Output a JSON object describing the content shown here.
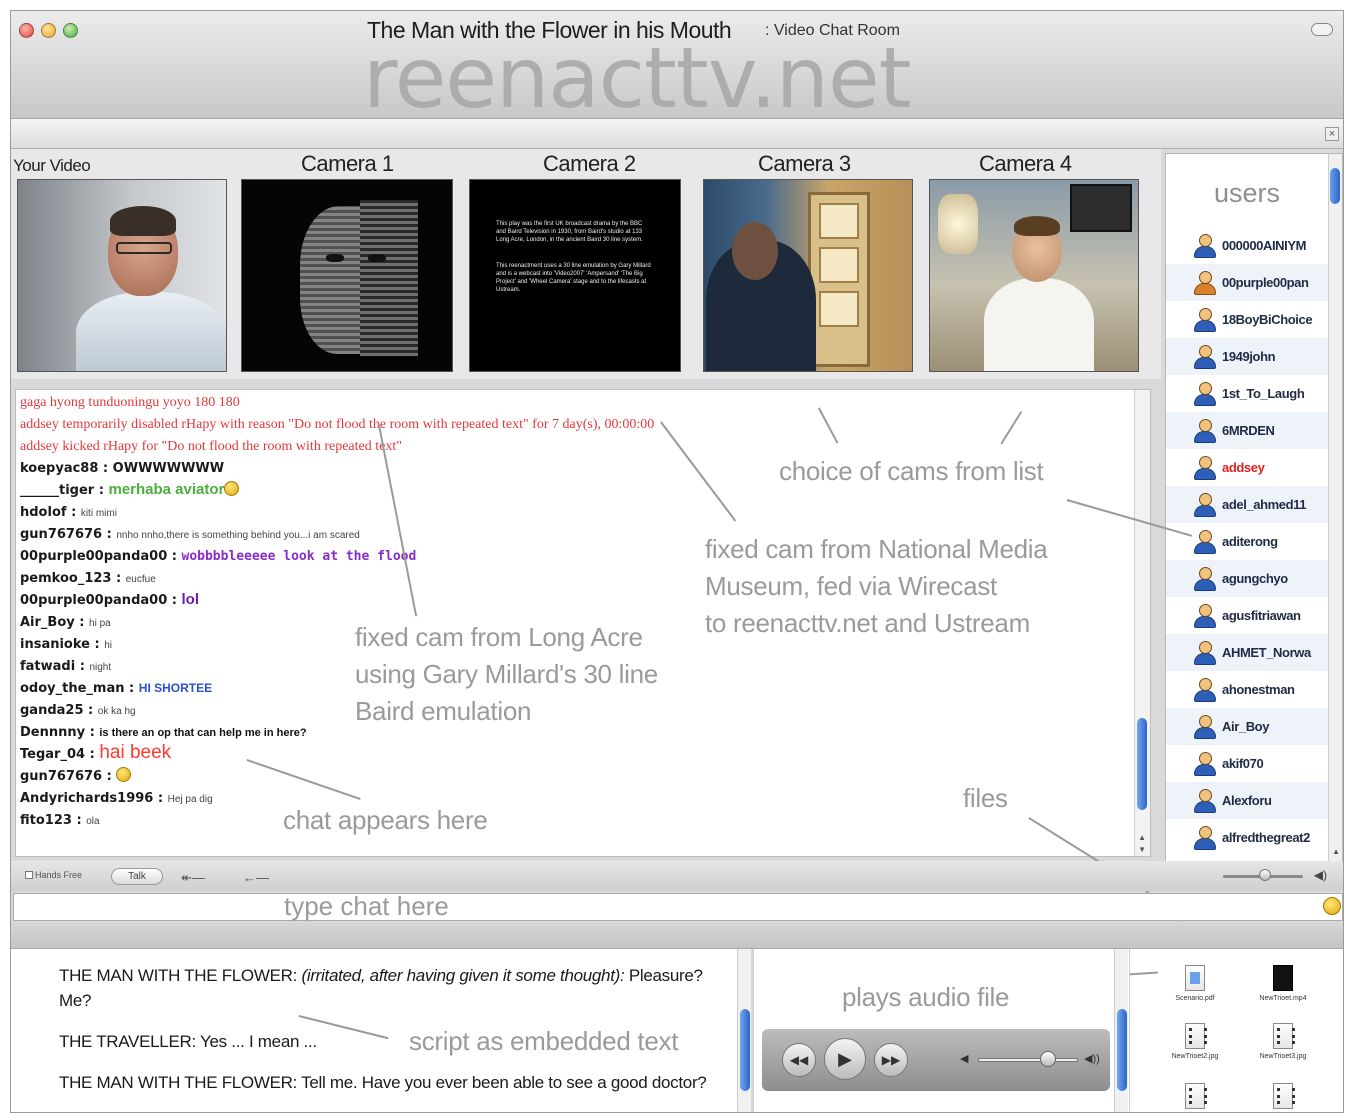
{
  "window": {
    "title": "The Man with the Flower in his Mouth",
    "subtitle": ": Video Chat Room",
    "watermark": "reenacttv.net",
    "close_label": "×"
  },
  "cameras": [
    {
      "label": "Your Video"
    },
    {
      "label": "Camera 1"
    },
    {
      "label": "Camera 2",
      "text": [
        "This play was the first UK broadcast drama by the BBC and Baird Television in 1930, from Baird's studio at 133 Long Acre, London, in the ancient Baird 30 line system.",
        "This reenactment uses a 30 line emulation by Gary Millard and is a webcast into 'Video2007' 'Ampersand' 'The Big Project' and 'Wheel Camera' stage and to the lifecasts at Ustream."
      ]
    },
    {
      "label": "Camera 3"
    },
    {
      "label": "Camera 4"
    }
  ],
  "users": {
    "title": "users",
    "items": [
      {
        "name": "000000AINIYM",
        "alt": false,
        "highlight": false
      },
      {
        "name": "00purple00pan",
        "alt": true,
        "highlight": false
      },
      {
        "name": "18BoyBiChoice",
        "alt": false,
        "highlight": false
      },
      {
        "name": "1949john",
        "alt": false,
        "highlight": false
      },
      {
        "name": "1st_To_Laugh",
        "alt": false,
        "highlight": false
      },
      {
        "name": "6MRDEN",
        "alt": false,
        "highlight": false
      },
      {
        "name": "addsey",
        "alt": false,
        "highlight": true
      },
      {
        "name": "adel_ahmed11",
        "alt": false,
        "highlight": false
      },
      {
        "name": "aditerong",
        "alt": false,
        "highlight": false
      },
      {
        "name": "agungchyo",
        "alt": false,
        "highlight": false
      },
      {
        "name": "agusfitriawan",
        "alt": false,
        "highlight": false
      },
      {
        "name": "AHMET_Norwa",
        "alt": false,
        "highlight": false
      },
      {
        "name": "ahonestman",
        "alt": false,
        "highlight": false
      },
      {
        "name": "Air_Boy",
        "alt": false,
        "highlight": false
      },
      {
        "name": "akif070",
        "alt": false,
        "highlight": false
      },
      {
        "name": "Alexforu",
        "alt": false,
        "highlight": false
      },
      {
        "name": "alfredthegreat2",
        "alt": false,
        "highlight": false
      }
    ]
  },
  "chat": {
    "lines": [
      {
        "type": "sys",
        "text": "gaga hyong tunduoningu yoyo 180 180"
      },
      {
        "type": "sys",
        "text": "addsey temporarily disabled rHapy with reason \"Do not flood the room with repeated text\" for 7 day(s), 00:00:00"
      },
      {
        "type": "sys",
        "text": "addsey kicked rHapy for \"Do not flood the room with repeated text\""
      },
      {
        "type": "msg",
        "user": "koepyac88",
        "msg": "OWWWWWWW",
        "style": "msg-dark-big"
      },
      {
        "type": "msg",
        "user": "______tiger",
        "msg": "merhaba aviator",
        "style": "green",
        "smiley": true
      },
      {
        "type": "msg",
        "user": "hdolof",
        "msg": "kiti mimi",
        "style": "small"
      },
      {
        "type": "msg",
        "user": "gun767676",
        "msg": "nnho nnho,there is something behind you...i am scared",
        "style": "small"
      },
      {
        "type": "msg",
        "user": "00purple00panda00",
        "msg": "wobbbbleeeee look at the flood",
        "style": "purple"
      },
      {
        "type": "msg",
        "user": "pemkoo_123",
        "msg": "eucfue",
        "style": "small"
      },
      {
        "type": "msg",
        "user": "00purple00panda00",
        "msg": "lol",
        "style": "purple-bold"
      },
      {
        "type": "msg",
        "user": "Air_Boy",
        "msg": "hi pa",
        "style": "small"
      },
      {
        "type": "msg",
        "user": "insanioke",
        "msg": "hi",
        "style": "small"
      },
      {
        "type": "msg",
        "user": "fatwadi",
        "msg": "night",
        "style": "small"
      },
      {
        "type": "msg",
        "user": "odoy_the_man",
        "msg": "HI SHORTEE",
        "style": "blue"
      },
      {
        "type": "msg",
        "user": "ganda25",
        "msg": "ok ka hg",
        "style": "small"
      },
      {
        "type": "msg",
        "user": "Dennnny",
        "msg": "is there an op that can help me in here?",
        "style": "dark"
      },
      {
        "type": "msg",
        "user": "Tegar_04",
        "msg": "hai beek",
        "style": "red"
      },
      {
        "type": "msg",
        "user": "gun767676",
        "msg": "",
        "style": "small",
        "smiley": true
      },
      {
        "type": "msg",
        "user": "Andyrichards1996",
        "msg": "Hej pa dig",
        "style": "small"
      },
      {
        "type": "msg",
        "user": "fito123",
        "msg": "ola",
        "style": "small"
      }
    ]
  },
  "annotations": {
    "choice_of_cams": "choice of cams from list",
    "fixed_cam_nmm": [
      "fixed cam from National Media",
      "Museum, fed via Wirecast",
      "to reenacttv.net and Ustream"
    ],
    "fixed_cam_long_acre": [
      "fixed cam from Long Acre",
      "using Gary Millard's 30 line",
      "Baird emulation"
    ],
    "chat_appears_here": "chat appears here",
    "files": "files",
    "plays_audio_file": "plays audio file",
    "script_as_text": "script as embedded text"
  },
  "talkbar": {
    "hands_free": "Hands Free",
    "talk": "Talk"
  },
  "input": {
    "placeholder": "type chat here"
  },
  "script": {
    "lines": [
      {
        "speaker": "THE MAN WITH THE FLOWER:",
        "direction": "(irritated, after having given it some thought):",
        "text": "Pleasure? Me?"
      },
      {
        "speaker": "THE TRAVELLER:",
        "direction": "",
        "text": "Yes ... I mean ..."
      },
      {
        "speaker": "THE MAN WITH THE FLOWER:",
        "direction": "",
        "text": "Tell me. Have you ever been able to see a good doctor?"
      }
    ]
  },
  "files": [
    {
      "name": "Scenario.pdf",
      "icon": "blue"
    },
    {
      "name": "NewTrioet.mp4",
      "icon": "dark"
    },
    {
      "name": "NewTrioet2.jpg",
      "icon": "film"
    },
    {
      "name": "NewTrioet3.jpg",
      "icon": "film"
    },
    {
      "name": "",
      "icon": "film"
    },
    {
      "name": "",
      "icon": "film"
    }
  ]
}
